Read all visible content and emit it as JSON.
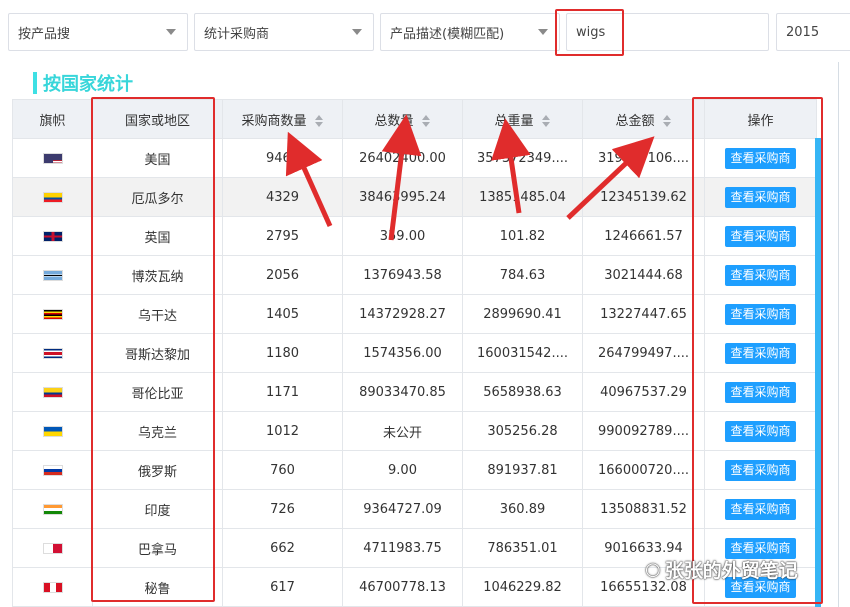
{
  "filters": {
    "search_mode": "按产品搜",
    "stat_type": "统计采购商",
    "match_mode": "产品描述(模糊匹配)",
    "keyword": "wigs",
    "year": "2015"
  },
  "section_title": "按国家统计",
  "table": {
    "headers": {
      "flag": "旗帜",
      "country": "国家或地区",
      "buyers": "采购商数量",
      "quantity": "总数量",
      "weight": "总重量",
      "amount": "总金额",
      "action": "操作"
    },
    "action_label": "查看采购商",
    "rows": [
      {
        "country": "美国",
        "buyers": "9468",
        "quantity": "26402400.00",
        "weight": "357372349....",
        "amount": "319077106....",
        "flag": "us-flag"
      },
      {
        "country": "厄瓜多尔",
        "buyers": "4329",
        "quantity": "38463995.24",
        "weight": "13851485.04",
        "amount": "12345139.62",
        "flag": "ecuador-flag"
      },
      {
        "country": "英国",
        "buyers": "2795",
        "quantity": "359.00",
        "weight": "101.82",
        "amount": "1246661.57",
        "flag": "uk-flag"
      },
      {
        "country": "博茨瓦纳",
        "buyers": "2056",
        "quantity": "1376943.58",
        "weight": "784.63",
        "amount": "3021444.68",
        "flag": "botswana-flag"
      },
      {
        "country": "乌干达",
        "buyers": "1405",
        "quantity": "14372928.27",
        "weight": "2899690.41",
        "amount": "13227447.65",
        "flag": "uganda-flag"
      },
      {
        "country": "哥斯达黎加",
        "buyers": "1180",
        "quantity": "1574356.00",
        "weight": "160031542....",
        "amount": "264799497....",
        "flag": "costa-rica-flag"
      },
      {
        "country": "哥伦比亚",
        "buyers": "1171",
        "quantity": "89033470.85",
        "weight": "5658938.63",
        "amount": "40967537.29",
        "flag": "colombia-flag"
      },
      {
        "country": "乌克兰",
        "buyers": "1012",
        "quantity": "未公开",
        "weight": "305256.28",
        "amount": "990092789....",
        "flag": "ukraine-flag"
      },
      {
        "country": "俄罗斯",
        "buyers": "760",
        "quantity": "9.00",
        "weight": "891937.81",
        "amount": "166000720....",
        "flag": "russia-flag"
      },
      {
        "country": "印度",
        "buyers": "726",
        "quantity": "9364727.09",
        "weight": "360.89",
        "amount": "13508831.52",
        "flag": "india-flag"
      },
      {
        "country": "巴拿马",
        "buyers": "662",
        "quantity": "4711983.75",
        "weight": "786351.01",
        "amount": "9016633.94",
        "flag": "panama-flag"
      },
      {
        "country": "秘鲁",
        "buyers": "617",
        "quantity": "46700778.13",
        "weight": "1046229.82",
        "amount": "16655132.08",
        "flag": "peru-flag"
      }
    ]
  },
  "watermark": "张张的外贸笔记",
  "colors": {
    "accent": "#38d6da",
    "button": "#1e9fff",
    "annotation": "#e02c2c"
  }
}
